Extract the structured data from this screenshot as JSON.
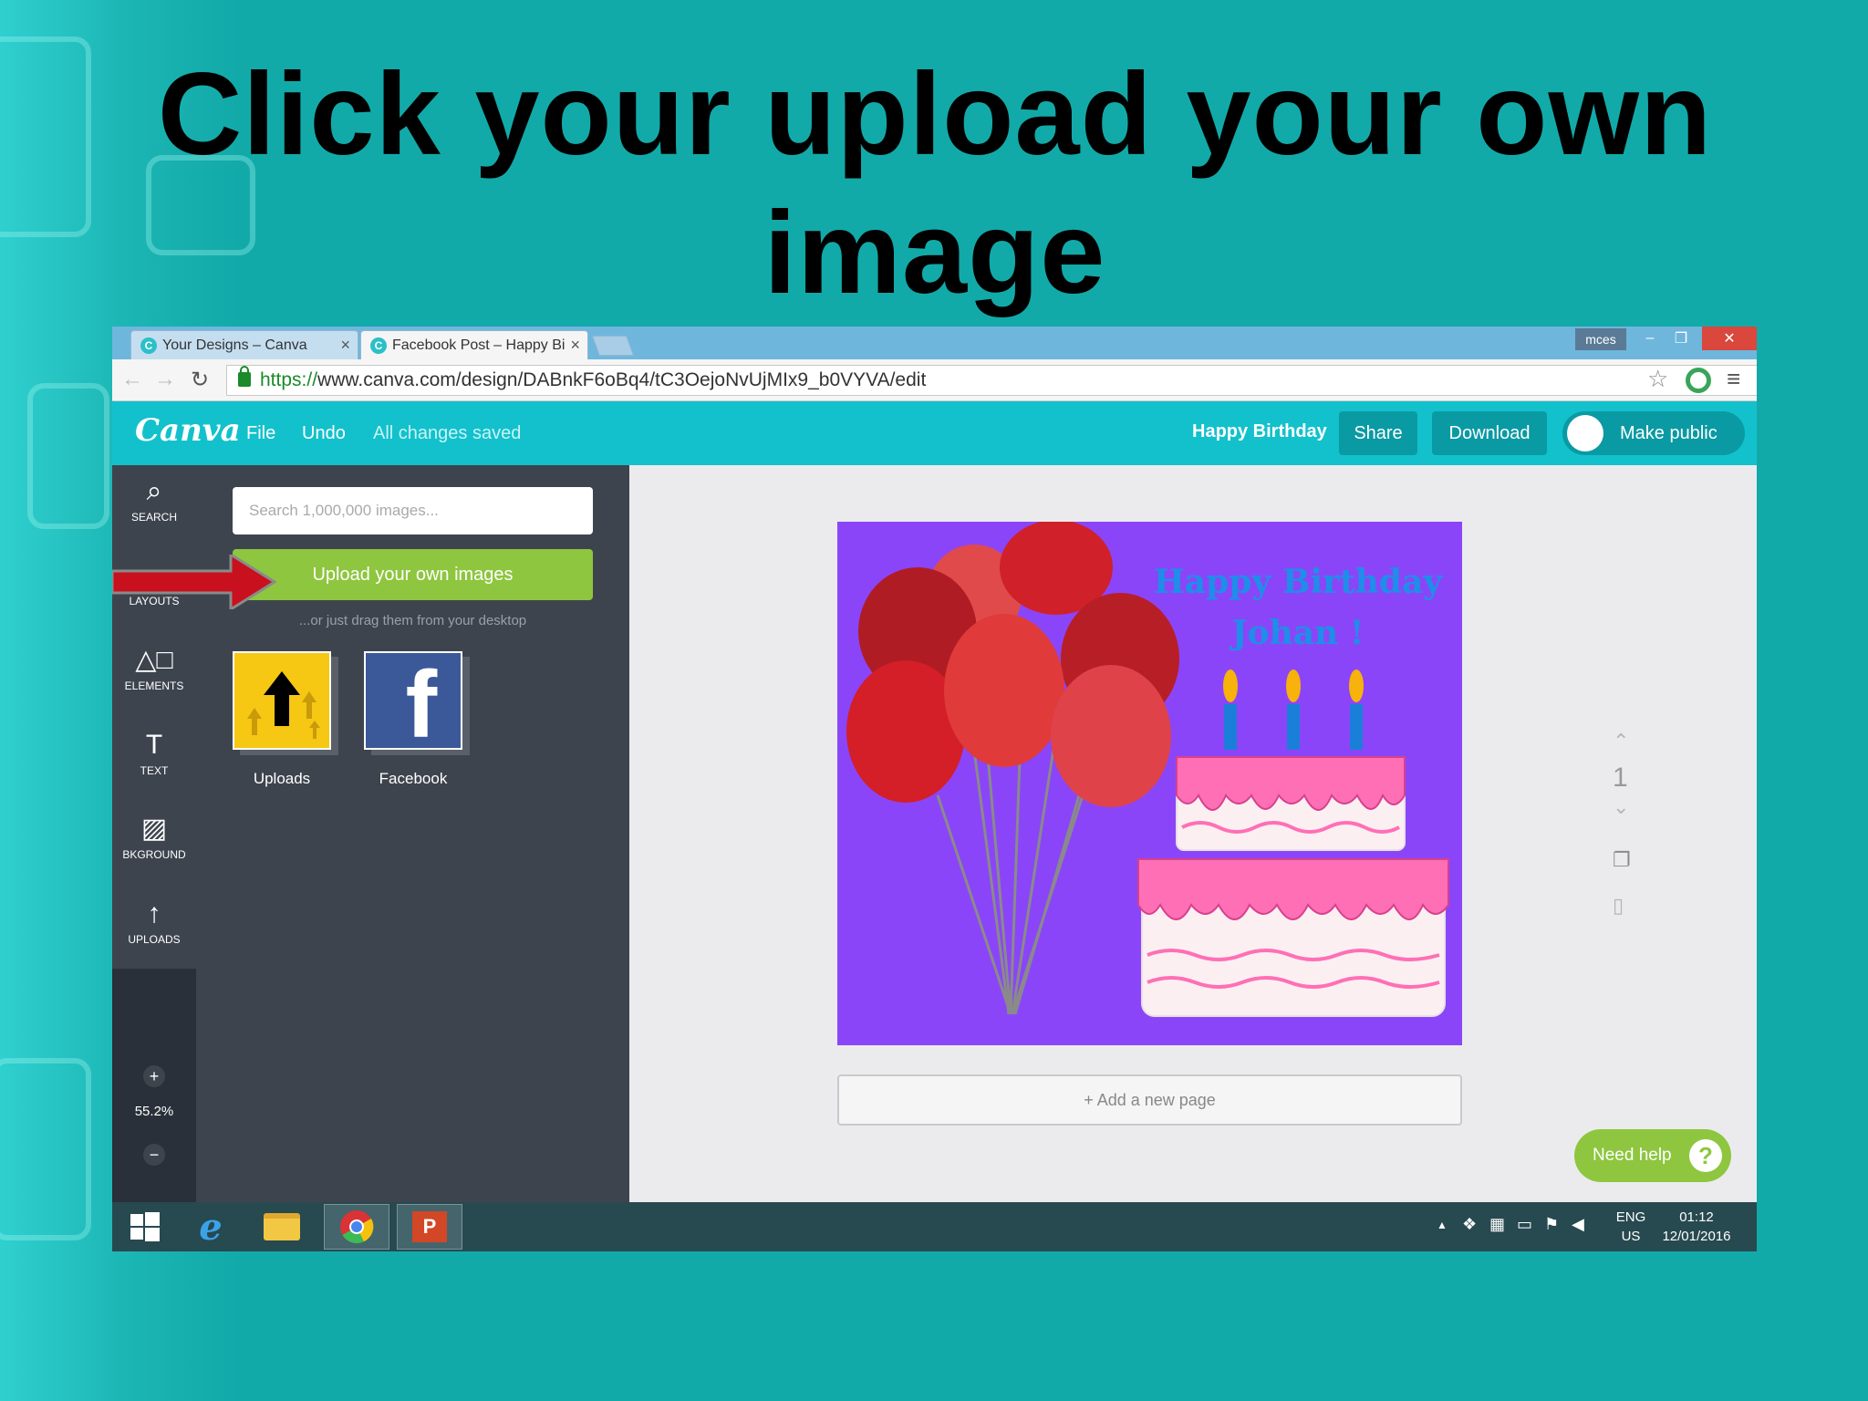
{
  "slide": {
    "title": "Click your upload your own image"
  },
  "browser": {
    "tabs": [
      {
        "label": "Your Designs – Canva",
        "favicon": "C"
      },
      {
        "label": "Facebook Post – Happy Bi",
        "favicon": "C"
      }
    ],
    "user_label": "mces",
    "url_scheme": "https://",
    "url_rest": "www.canva.com/design/DABnkF6oBq4/tC3OejoNvUjMIx9_b0VYVA/edit"
  },
  "canva_bar": {
    "logo": "Canva",
    "file_label": "File",
    "undo_label": "Undo",
    "status": "All changes saved",
    "design_title": "Happy Birthday",
    "share_label": "Share",
    "download_label": "Download",
    "make_public_label": "Make public"
  },
  "rail": {
    "items": [
      {
        "label": "SEARCH",
        "icon": "search-icon"
      },
      {
        "label": "LAYOUTS",
        "icon": "layouts-icon"
      },
      {
        "label": "ELEMENTS",
        "icon": "elements-icon"
      },
      {
        "label": "TEXT",
        "icon": "text-icon"
      },
      {
        "label": "BKGROUND",
        "icon": "background-icon"
      },
      {
        "label": "UPLOADS",
        "icon": "uploads-icon"
      }
    ],
    "zoom_in": "+",
    "zoom_level": "55.2%",
    "zoom_out": "−"
  },
  "panel": {
    "search_placeholder": "Search 1,000,000 images...",
    "upload_button": "Upload your own images",
    "drag_hint": "...or just drag them from your desktop",
    "folders": [
      {
        "label": "Uploads"
      },
      {
        "label": "Facebook"
      }
    ]
  },
  "design": {
    "greeting_line1": "Happy Birthday",
    "greeting_line2": "Johan !",
    "add_page_label": "+ Add a new page",
    "page_number": "1",
    "need_help_label": "Need help",
    "need_help_icon": "?"
  },
  "taskbar": {
    "lang_top": "ENG",
    "lang_bottom": "US",
    "time": "01:12",
    "date": "12/01/2016"
  },
  "colors": {
    "slide_bg": "#12aaa9",
    "canva_teal": "#12c1cc",
    "panel_dark": "#3e444e",
    "upload_green": "#8ec63f",
    "design_purple": "#8b45f8",
    "arrow_red": "#c8101e"
  }
}
